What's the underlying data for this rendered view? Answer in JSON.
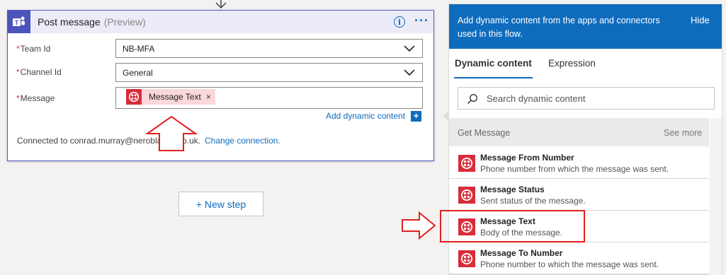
{
  "card": {
    "title": "Post message",
    "subtitle": "(Preview)",
    "info_glyph": "i",
    "more_glyph": "···",
    "fields": [
      {
        "label": "Team Id",
        "required": "*",
        "value": "NB-MFA"
      },
      {
        "label": "Channel Id",
        "required": "*",
        "value": "General"
      },
      {
        "label": "Message",
        "required": "*",
        "token": "Message Text",
        "token_close": "×"
      }
    ],
    "add_dynamic_label": "Add dynamic content",
    "add_dynamic_glyph": "+",
    "connected_text": "Connected to conrad.murray@neroblanco.co.uk.",
    "change_connection": "Change connection."
  },
  "new_step_label": "+ New step",
  "panel": {
    "header_text": "Add dynamic content from the apps and connectors used in this flow.",
    "hide_label": "Hide",
    "tabs": [
      {
        "label": "Dynamic content",
        "active": true
      },
      {
        "label": "Expression",
        "active": false
      }
    ],
    "search_placeholder": "Search dynamic content",
    "section_title": "Get Message",
    "see_more": "See more",
    "items": [
      {
        "title": "Message From Number",
        "desc": "Phone number from which the message was sent."
      },
      {
        "title": "Message Status",
        "desc": "Sent status of the message."
      },
      {
        "title": "Message Text",
        "desc": "Body of the message."
      },
      {
        "title": "Message To Number",
        "desc": "Phone number to which the message was sent."
      }
    ]
  },
  "colors": {
    "accent": "#0f6cbd",
    "teams_purple": "#4b53bc",
    "twilio_red": "#d92c3a",
    "annotation_red": "#e02020"
  },
  "icons": {
    "teams": "microsoft-teams-icon",
    "twilio": "twilio-icon",
    "search": "search-icon",
    "chevron": "chevron-down-icon"
  }
}
